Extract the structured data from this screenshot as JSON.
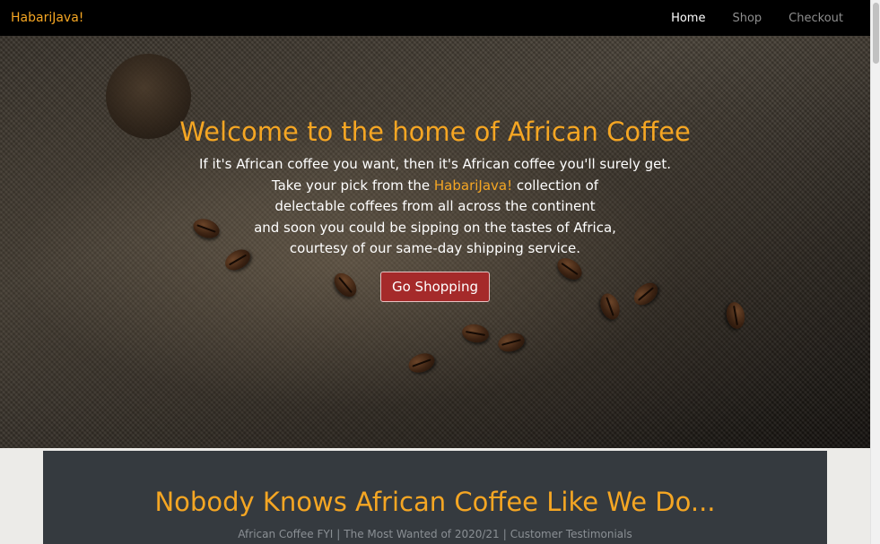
{
  "navbar": {
    "brand": "HabariJava!",
    "links": [
      {
        "label": "Home",
        "active": true
      },
      {
        "label": "Shop",
        "active": false
      },
      {
        "label": "Checkout",
        "active": false
      }
    ]
  },
  "hero": {
    "title": "Welcome to the home of African Coffee",
    "line1": "If it's African coffee you want, then it's African coffee you'll surely get.",
    "line2_before": "Take your pick from the ",
    "line2_brand": "HabariJava!",
    "line2_after": " collection of",
    "line3": "delectable coffees from all across the continent",
    "line4": "and soon you could be sipping on the tastes of Africa,",
    "line5": "courtesy of our same-day shipping service.",
    "cta_label": "Go Shopping"
  },
  "section": {
    "title": "Nobody Knows African Coffee Like We Do...",
    "links": [
      "African Coffee FYI",
      "The Most Wanted of 2020/21",
      "Customer Testimonials"
    ],
    "separator": "|"
  },
  "colors": {
    "accent": "#f5a623",
    "cta": "#a52a2a",
    "panel": "#353a3f",
    "navbar": "#000000"
  }
}
